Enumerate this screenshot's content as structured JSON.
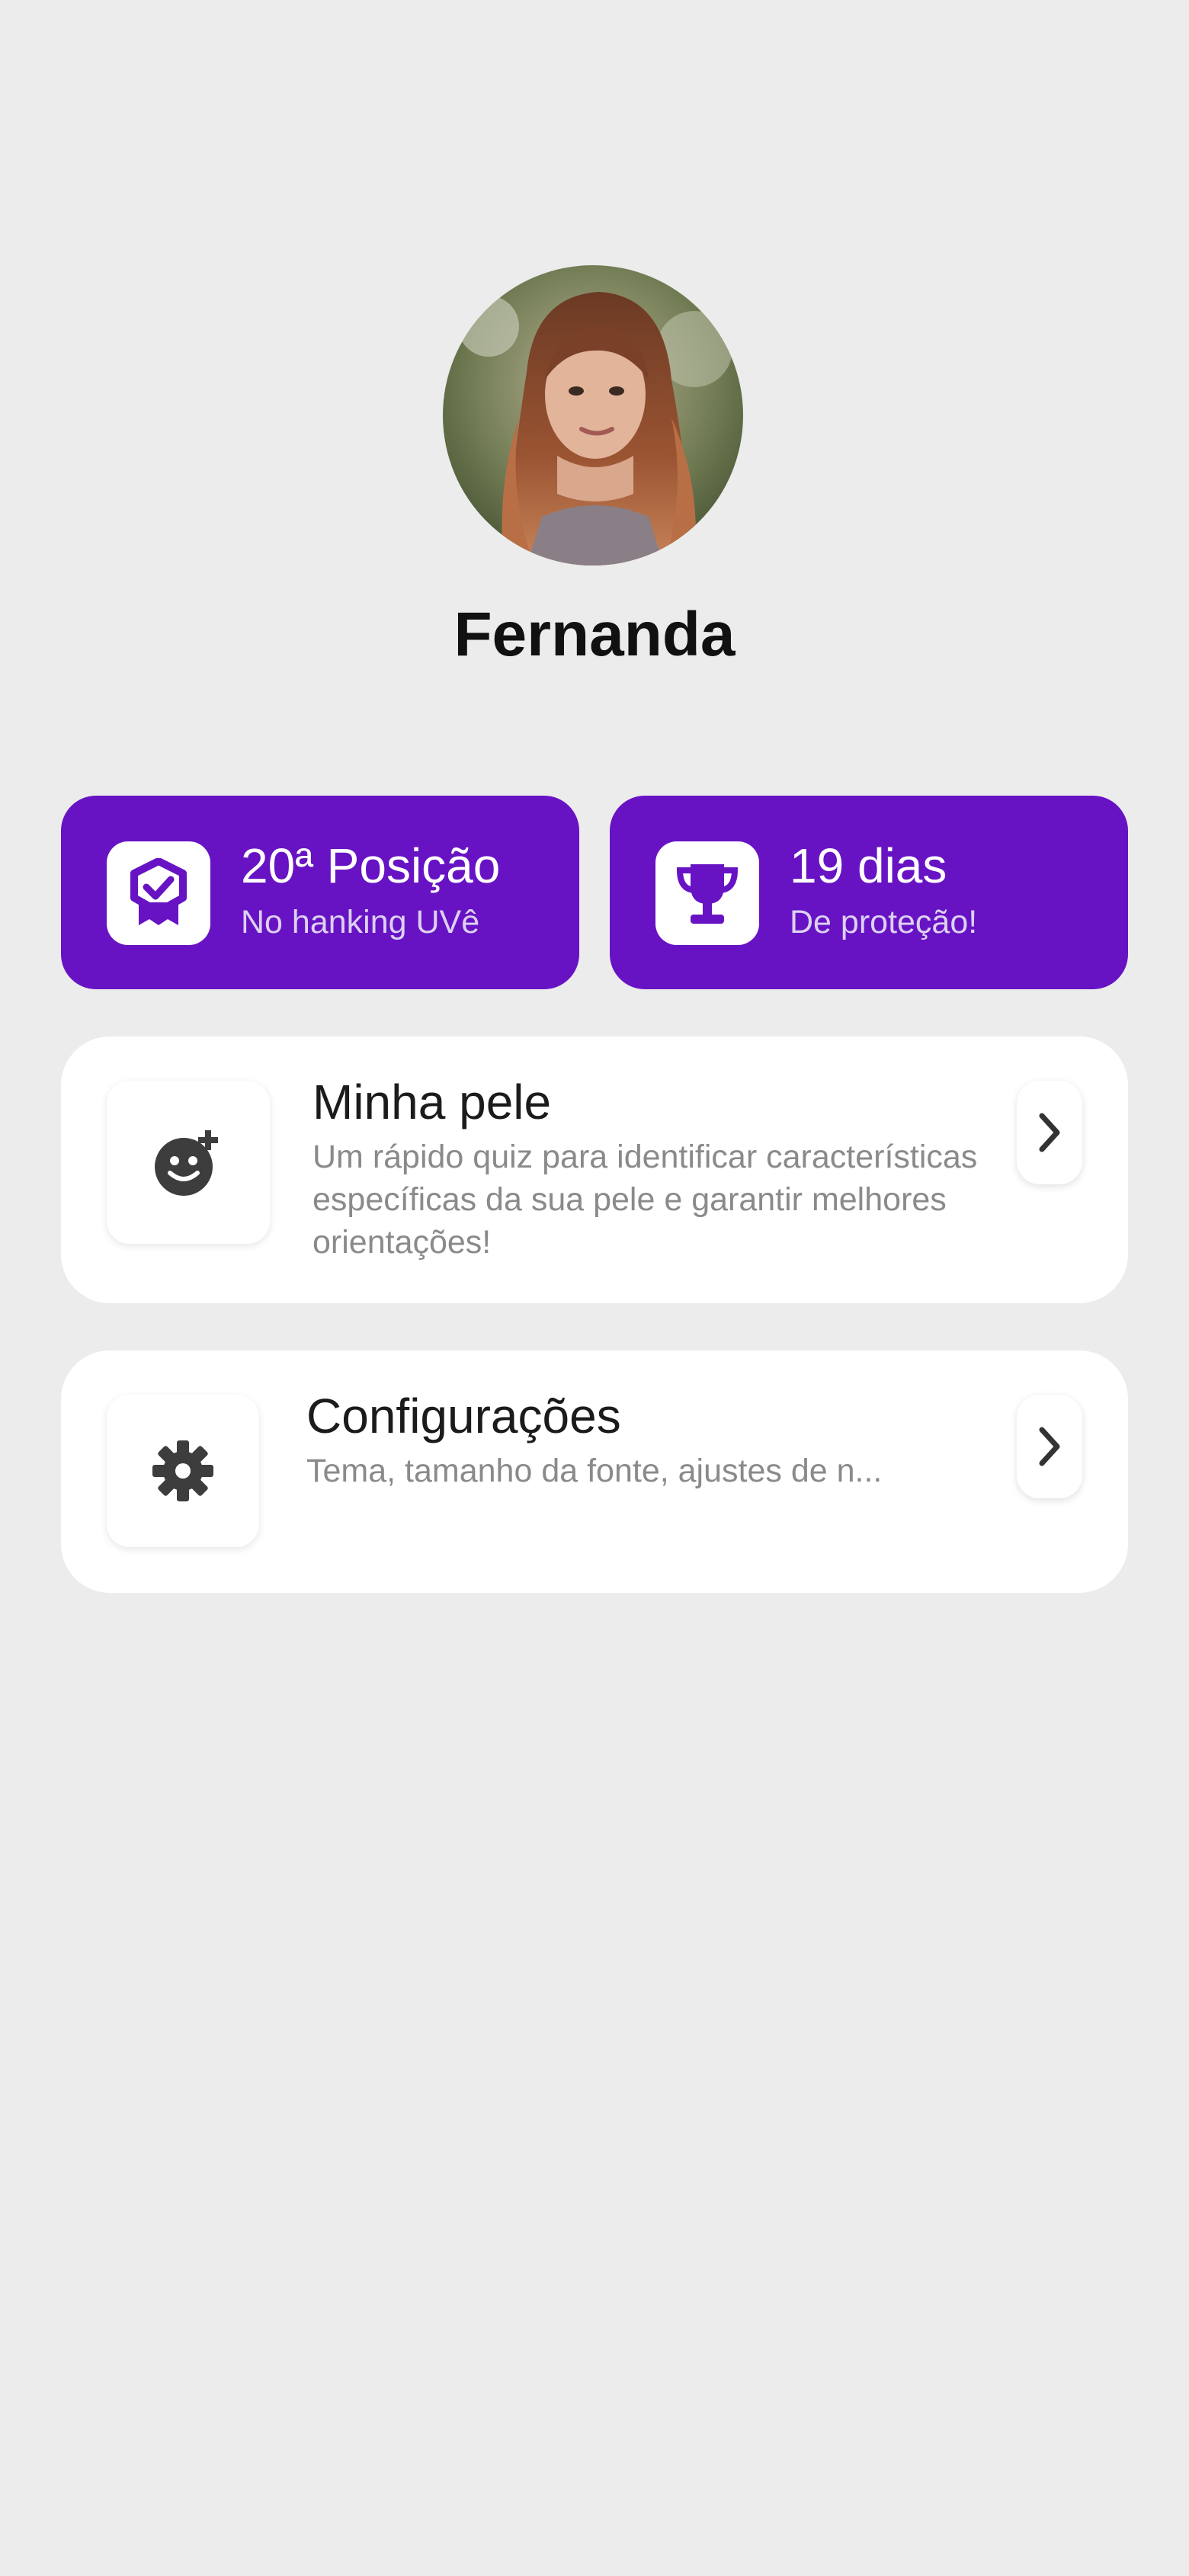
{
  "profile": {
    "name": "Fernanda"
  },
  "stats": [
    {
      "title": "20ª Posição",
      "subtitle": "No hanking UVê",
      "icon": "badge-check-icon"
    },
    {
      "title": "19 dias",
      "subtitle": "De proteção!",
      "icon": "trophy-icon"
    }
  ],
  "cards": {
    "skin": {
      "title": "Minha pele",
      "description": "Um rápido quiz para identificar características específicas da sua pele e garantir melhores orientações!",
      "icon": "smiley-plus-icon"
    },
    "settings": {
      "title": "Configurações",
      "description": "Tema, tamanho da fonte, ajustes de n...",
      "icon": "gear-icon"
    }
  },
  "colors": {
    "accent": "#6713c4",
    "background": "#ececec",
    "card": "#ffffff",
    "icon_dark": "#3d3d3d"
  }
}
